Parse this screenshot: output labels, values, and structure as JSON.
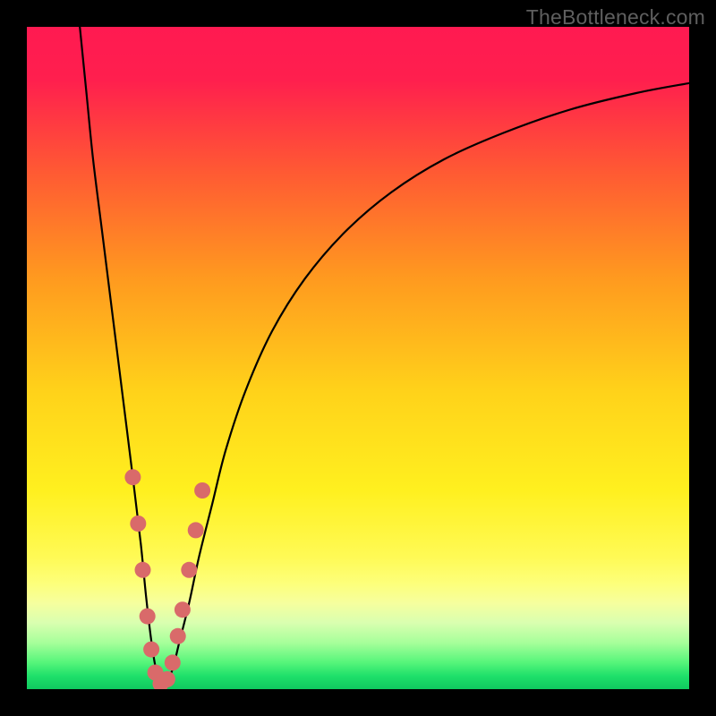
{
  "watermark": "TheBottleneck.com",
  "chart_data": {
    "type": "line",
    "title": "",
    "xlabel": "",
    "ylabel": "",
    "xlim": [
      0,
      100
    ],
    "ylim": [
      0,
      100
    ],
    "gradient_stops": [
      {
        "pct": 0,
        "color": "#ff1a51"
      },
      {
        "pct": 8,
        "color": "#ff1f4e"
      },
      {
        "pct": 22,
        "color": "#ff5a33"
      },
      {
        "pct": 38,
        "color": "#ff9a1f"
      },
      {
        "pct": 55,
        "color": "#ffd21a"
      },
      {
        "pct": 70,
        "color": "#fff01f"
      },
      {
        "pct": 80,
        "color": "#fffa55"
      },
      {
        "pct": 84,
        "color": "#fdff7a"
      },
      {
        "pct": 87,
        "color": "#f6ff9e"
      },
      {
        "pct": 90,
        "color": "#d9ffb0"
      },
      {
        "pct": 93,
        "color": "#a6ff9a"
      },
      {
        "pct": 96,
        "color": "#55f57a"
      },
      {
        "pct": 98,
        "color": "#1fe06a"
      },
      {
        "pct": 100,
        "color": "#0fc95f"
      }
    ],
    "series": [
      {
        "name": "bottleneck-curve",
        "x": [
          8,
          9,
          10,
          11.5,
          13,
          14.5,
          16,
          17.2,
          18,
          18.7,
          19.3,
          20,
          21,
          22,
          23,
          24.5,
          26,
          28,
          30,
          33,
          37,
          42,
          48,
          55,
          63,
          72,
          82,
          92,
          100
        ],
        "y": [
          100,
          90,
          80,
          68,
          56,
          44,
          32,
          22,
          14,
          8,
          4,
          1,
          1,
          3,
          7,
          13,
          20,
          28,
          36,
          45,
          54,
          62,
          69,
          75,
          80,
          84,
          87.5,
          90,
          91.5
        ]
      }
    ],
    "markers": {
      "name": "highlight-points",
      "color": "#d96a6a",
      "radius_px": 9,
      "points": [
        {
          "x": 16.0,
          "y": 32
        },
        {
          "x": 16.8,
          "y": 25
        },
        {
          "x": 17.5,
          "y": 18
        },
        {
          "x": 18.2,
          "y": 11
        },
        {
          "x": 18.8,
          "y": 6
        },
        {
          "x": 19.4,
          "y": 2.5
        },
        {
          "x": 20.2,
          "y": 0.8
        },
        {
          "x": 21.2,
          "y": 1.5
        },
        {
          "x": 22.0,
          "y": 4
        },
        {
          "x": 22.8,
          "y": 8
        },
        {
          "x": 23.5,
          "y": 12
        },
        {
          "x": 24.5,
          "y": 18
        },
        {
          "x": 25.5,
          "y": 24
        },
        {
          "x": 26.5,
          "y": 30
        }
      ]
    }
  }
}
